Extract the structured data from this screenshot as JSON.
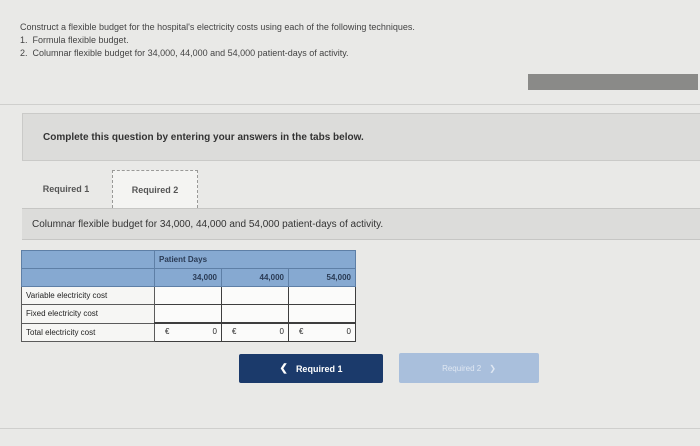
{
  "intro": {
    "line1": "Construct a flexible budget for the hospital's electricity costs using each of the following techniques.",
    "items": [
      {
        "num": "1.",
        "text": "Formula flexible budget."
      },
      {
        "num": "2.",
        "text": "Columnar flexible budget for 34,000, 44,000 and 54,000 patient-days of activity."
      }
    ]
  },
  "banner": "Complete this question by entering your answers in the tabs below.",
  "tabs": [
    {
      "label": "Required 1"
    },
    {
      "label": "Required 2"
    }
  ],
  "panel_title": "Columnar flexible budget for 34,000, 44,000 and 54,000 patient-days of activity.",
  "table": {
    "group_header": "Patient Days",
    "columns": [
      "34,000",
      "44,000",
      "54,000"
    ],
    "rows": [
      {
        "label": "Variable electricity cost",
        "values": [
          "",
          "",
          ""
        ]
      },
      {
        "label": "Fixed electricity cost",
        "values": [
          "",
          "",
          ""
        ]
      }
    ],
    "total": {
      "label": "Total electricity cost",
      "currency": "€",
      "values": [
        "0",
        "0",
        "0"
      ]
    }
  },
  "nav": {
    "prev_label": "Required 1",
    "next_label": "Required 2"
  }
}
